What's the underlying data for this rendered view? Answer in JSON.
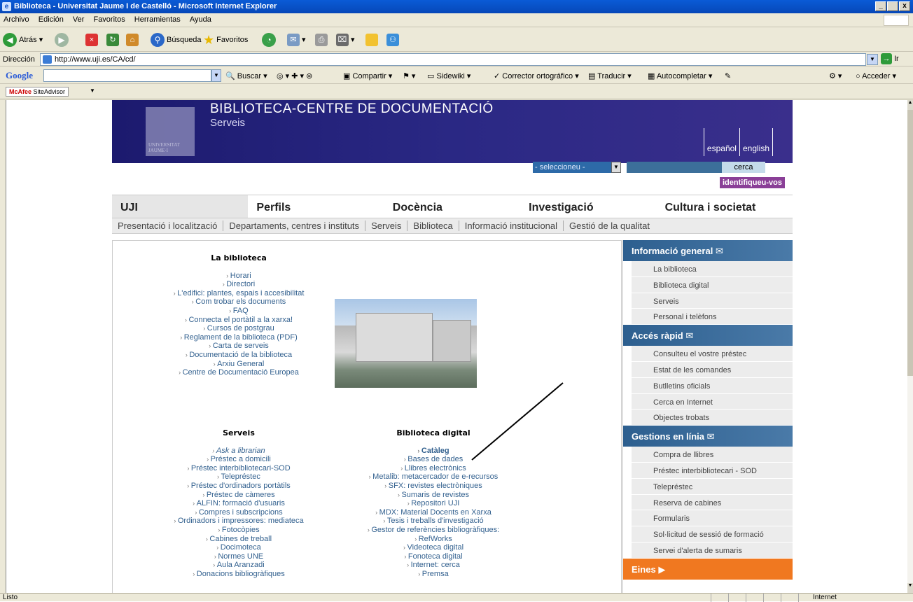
{
  "window": {
    "title": "Biblioteca - Universitat Jaume I de Castelló - Microsoft Internet Explorer",
    "btn_min": "_",
    "btn_max": " ",
    "btn_close": "x"
  },
  "menu": [
    "Archivo",
    "Edición",
    "Ver",
    "Favoritos",
    "Herramientas",
    "Ayuda"
  ],
  "toolbar": {
    "back": "Atrás",
    "search": "Búsqueda",
    "favorites": "Favoritos"
  },
  "address": {
    "label": "Dirección",
    "url": "http://www.uji.es/CA/cd/",
    "go": "Ir"
  },
  "google": {
    "logo": "Google",
    "buscar": "Buscar",
    "compartir": "Compartir",
    "sidewiki": "Sidewiki",
    "corrector": "Corrector ortográfico",
    "traducir": "Traducir",
    "autocompletar": "Autocompletar",
    "acceder": "Acceder"
  },
  "mcafee": {
    "brand": "McAfee",
    "product": "SiteAdvisor"
  },
  "status": {
    "text": "Listo",
    "zone": "Internet"
  },
  "page": {
    "title": "BIBLIOTECA-CENTRE DE DOCUMENTACIÓ",
    "subtitle": "Serveis",
    "logo_text": "UNIVERSITAT JAUME·I",
    "lang": [
      "español",
      "english"
    ],
    "select_placeholder": "- seleccioneu -",
    "search_btn": "cerca",
    "identify": "identifiqueu-vos",
    "mainnav": [
      "UJI",
      "Perfils",
      "Docència",
      "Investigació",
      "Cultura i societat"
    ],
    "subnav": [
      "Presentació i localització",
      "Departaments, centres i instituts",
      "Serveis",
      "Biblioteca",
      "Informació institucional",
      "Gestió de la qualitat"
    ],
    "biblioteca": {
      "heading": "La biblioteca",
      "items": [
        "Horari",
        "Directori",
        "L'edifici: plantes, espais i accesibilitat",
        "Com trobar els documents",
        "FAQ",
        "Connecta el portàtil a la xarxa!",
        "Cursos de postgrau",
        "Reglament de la biblioteca (PDF)",
        "Carta de serveis",
        "Documentació de la biblioteca",
        "Arxiu General",
        "Centre de Documentació Europea"
      ]
    },
    "serveis": {
      "heading": "Serveis",
      "items": [
        "Ask a librarian",
        "Préstec a domicili",
        "Préstec interbibliotecari-SOD",
        "Telepréstec",
        "Préstec d'ordinadors portàtils",
        "Préstec de càmeres",
        "ALFIN: formació d'usuaris",
        "Compres i subscripcions",
        "Ordinadors i impressores: mediateca",
        "Fotocòpies",
        "Cabines de treball",
        "Docimoteca",
        "Normes UNE",
        "Aula Aranzadi",
        "Donacions bibliogràfiques"
      ]
    },
    "digital": {
      "heading": "Biblioteca digital",
      "items": [
        "Catàleg",
        "Bases de dades",
        "Llibres electrònics",
        "Metalib: metacercador de e-recursos",
        "SFX: revistes electròniques",
        "Sumaris de revistes",
        "Repositori UJI",
        "MDX: Material Docents en Xarxa",
        "Tesis i treballs d'investigació",
        "Gestor de referències bibliogràfiques:",
        "RefWorks",
        "Videoteca digital",
        "Fonoteca digital",
        "Internet: cerca",
        "Premsa"
      ]
    },
    "side": {
      "info": {
        "heading": "Informació general",
        "items": [
          "La biblioteca",
          "Biblioteca digital",
          "Serveis",
          "Personal i telèfons"
        ]
      },
      "rapid": {
        "heading": "Accés ràpid",
        "items": [
          "Consulteu el vostre préstec",
          "Estat de les comandes",
          "Butlletins oficials",
          "Cerca en Internet",
          "Objectes trobats"
        ]
      },
      "gestions": {
        "heading": "Gestions en línia",
        "items": [
          "Compra de llibres",
          "Préstec interbibliotecari - SOD",
          "Telepréstec",
          "Reserva de cabines",
          "Formularis",
          "Sol·licitud de sessió de formació",
          "Servei d'alerta de sumaris"
        ]
      },
      "eines": {
        "heading": "Eines"
      }
    }
  }
}
